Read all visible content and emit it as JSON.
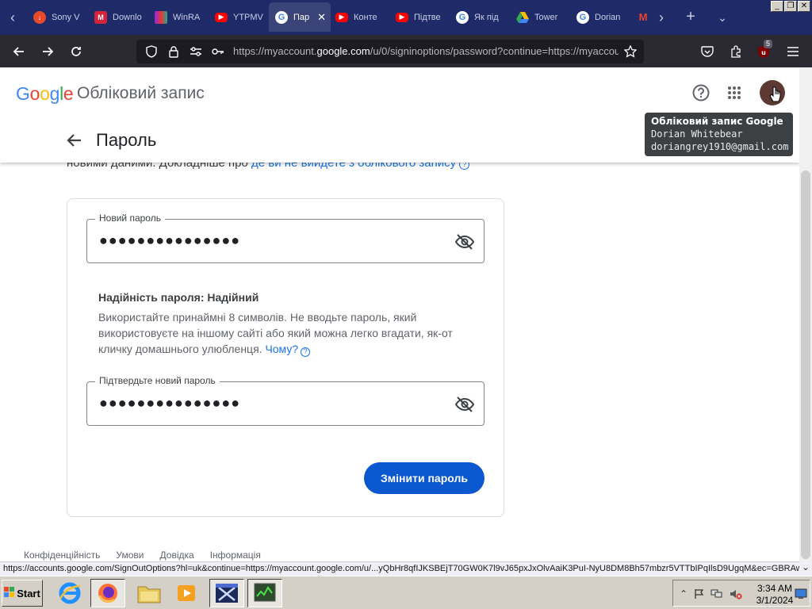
{
  "browser": {
    "tabs": [
      {
        "title": "Sony V",
        "icon": "download-icon",
        "color": "#e8492b"
      },
      {
        "title": "Downlo",
        "icon": "m-logo-icon",
        "color": "#d4243a"
      },
      {
        "title": "WinRA",
        "icon": "winrar-icon",
        "color": "#8a2be2"
      },
      {
        "title": "YTPMV",
        "icon": "youtube-icon",
        "color": "#ff0000"
      },
      {
        "title": "Пар",
        "icon": "google-g-icon",
        "color": "#4285f4",
        "active": true
      },
      {
        "title": "Конте",
        "icon": "youtube-icon",
        "color": "#ff0000"
      },
      {
        "title": "Підтве",
        "icon": "youtube-icon",
        "color": "#ff0000"
      },
      {
        "title": "Як під",
        "icon": "google-g-icon",
        "color": "#4285f4"
      },
      {
        "title": "Tower",
        "icon": "google-drive-icon",
        "color": "#34a853"
      },
      {
        "title": "Dorian",
        "icon": "google-g-icon",
        "color": "#4285f4"
      },
      {
        "title": "",
        "icon": "gmail-icon",
        "color": "#ea4335"
      }
    ],
    "url_prefix": "https://myaccount.",
    "url_domain": "google.com",
    "url_suffix": "/u/0/signinoptions/password?continue=https://myaccou",
    "extension_badge": "5",
    "status_url": "https://accounts.google.com/SignOutOptions?hl=uk&continue=https://myaccount.google.com/u/...yQbHr8qfIJKSBEjT70GW0K7l9vJ65pxJxOlvAaiK3PuI-NyU8DM8Bh57mbzr5VTTbIPqIlsD9UgqM&ec=GBRAwAE"
  },
  "header": {
    "logo": {
      "G": "G",
      "o1": "o",
      "o2": "o",
      "g": "g",
      "l": "l",
      "e": "e"
    },
    "account_title": "Обліковий запис",
    "page_title": "Пароль"
  },
  "tooltip": {
    "title": "Обліковий запис Google",
    "name": "Dorian Whitebear",
    "email": "doriangrey1910@gmail.com"
  },
  "under_text": {
    "prefix": "новими даними. Докладніше про ",
    "link": "де ви не вийдете з облікового запису"
  },
  "form": {
    "new_password_label": "Новий пароль",
    "new_password_value": "●●●●●●●●●●●●●●●",
    "strength": "Надійність пароля: Надійний",
    "hint_text": "Використайте принаймні 8 символів. Не вводьте пароль, який використовуєте на іншому сайті або який можна легко вгадати, як-от кличку домашнього улюбленця. ",
    "hint_link": "Чому?",
    "confirm_label": "Підтвердьте новий пароль",
    "confirm_value": "●●●●●●●●●●●●●●●",
    "submit_label": "Змінити пароль"
  },
  "footer": {
    "links": [
      "Конфіденційність",
      "Умови",
      "Довідка",
      "Інформація"
    ]
  },
  "taskbar": {
    "start_label": "Start",
    "time": "3:34 AM",
    "date": "3/1/2024"
  }
}
